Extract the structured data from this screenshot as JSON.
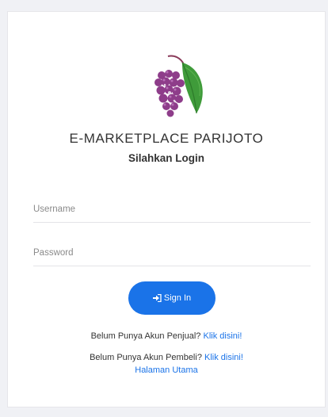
{
  "brand": {
    "app_title": "E-MARKETPLACE PARIJOTO",
    "logo_icon": "parijoto-fruit-logo-icon"
  },
  "login": {
    "heading": "Silahkan Login",
    "username_placeholder": "Username",
    "password_placeholder": "Password",
    "signin_label": "Sign In",
    "signin_icon": "sign-in-icon"
  },
  "links": {
    "seller_prompt": "Belum Punya Akun Penjual?",
    "seller_link": "Klik disini!",
    "buyer_prompt": "Belum Punya Akun Pembeli?",
    "buyer_link": "Klik disini!",
    "home_link": "Halaman Utama"
  },
  "colors": {
    "accent": "#1a73e8",
    "background": "#f0f1f5",
    "card": "#ffffff",
    "text": "#333333"
  }
}
